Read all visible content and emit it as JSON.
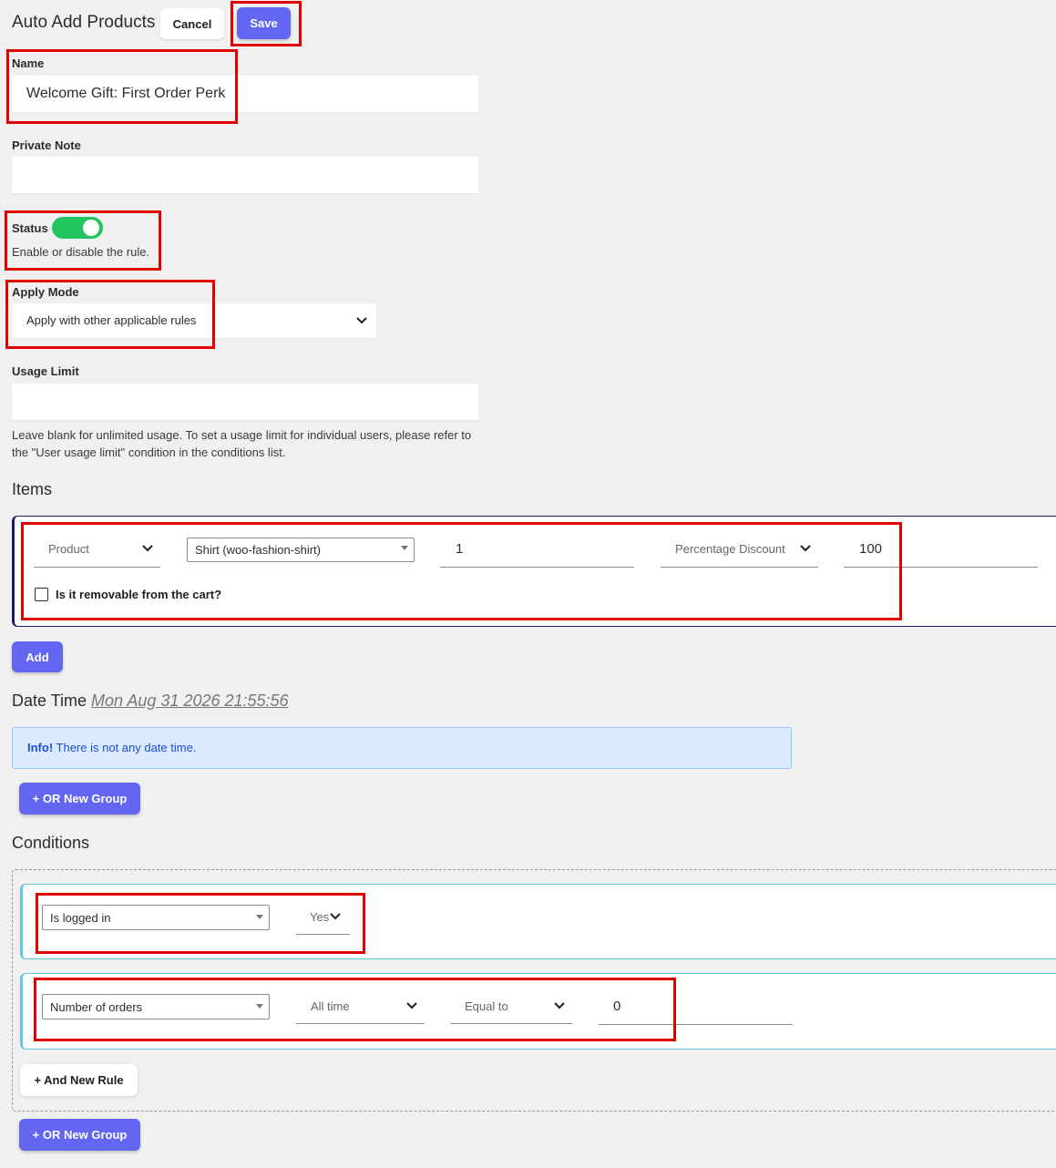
{
  "header": {
    "title": "Auto Add Products",
    "cancel_label": "Cancel",
    "save_label": "Save"
  },
  "form": {
    "name_label": "Name",
    "name_value": "Welcome Gift: First Order Perk",
    "note_label": "Private Note",
    "note_value": "",
    "status_label": "Status",
    "status_on": true,
    "status_help": "Enable or disable the rule.",
    "apply_mode_label": "Apply Mode",
    "apply_mode_value": "Apply with other applicable rules",
    "usage_limit_label": "Usage Limit",
    "usage_limit_value": "",
    "usage_help": "Leave blank for unlimited usage. To set a usage limit for individual users, please refer to the \"User usage limit\" condition in the conditions list."
  },
  "items": {
    "title": "Items",
    "row": {
      "type": "Product",
      "product": "Shirt (woo-fashion-shirt)",
      "quantity": "1",
      "discount_type": "Percentage Discount",
      "discount_value": "100"
    },
    "removable_label": "Is it removable from the cart?",
    "removable_checked": false,
    "add_label": "Add"
  },
  "datetime": {
    "title": "Date Time",
    "value": "Mon Aug 31 2026 21:55:56",
    "info_strong": "Info!",
    "info_text": " There is not any date time.",
    "or_group_label": "+ OR New Group"
  },
  "conditions": {
    "title": "Conditions",
    "rule1": {
      "field": "Is logged in",
      "value": "Yes"
    },
    "rule2": {
      "field": "Number of orders",
      "period": "All time",
      "operator": "Equal to",
      "value": "0"
    },
    "and_rule_label": "+ And New Rule",
    "or_group_label": "+ OR New Group"
  },
  "colors": {
    "accent": "#6366f1",
    "toggle_on": "#22c55e",
    "highlight": "#e00000",
    "info_bg": "#dbeafe"
  }
}
